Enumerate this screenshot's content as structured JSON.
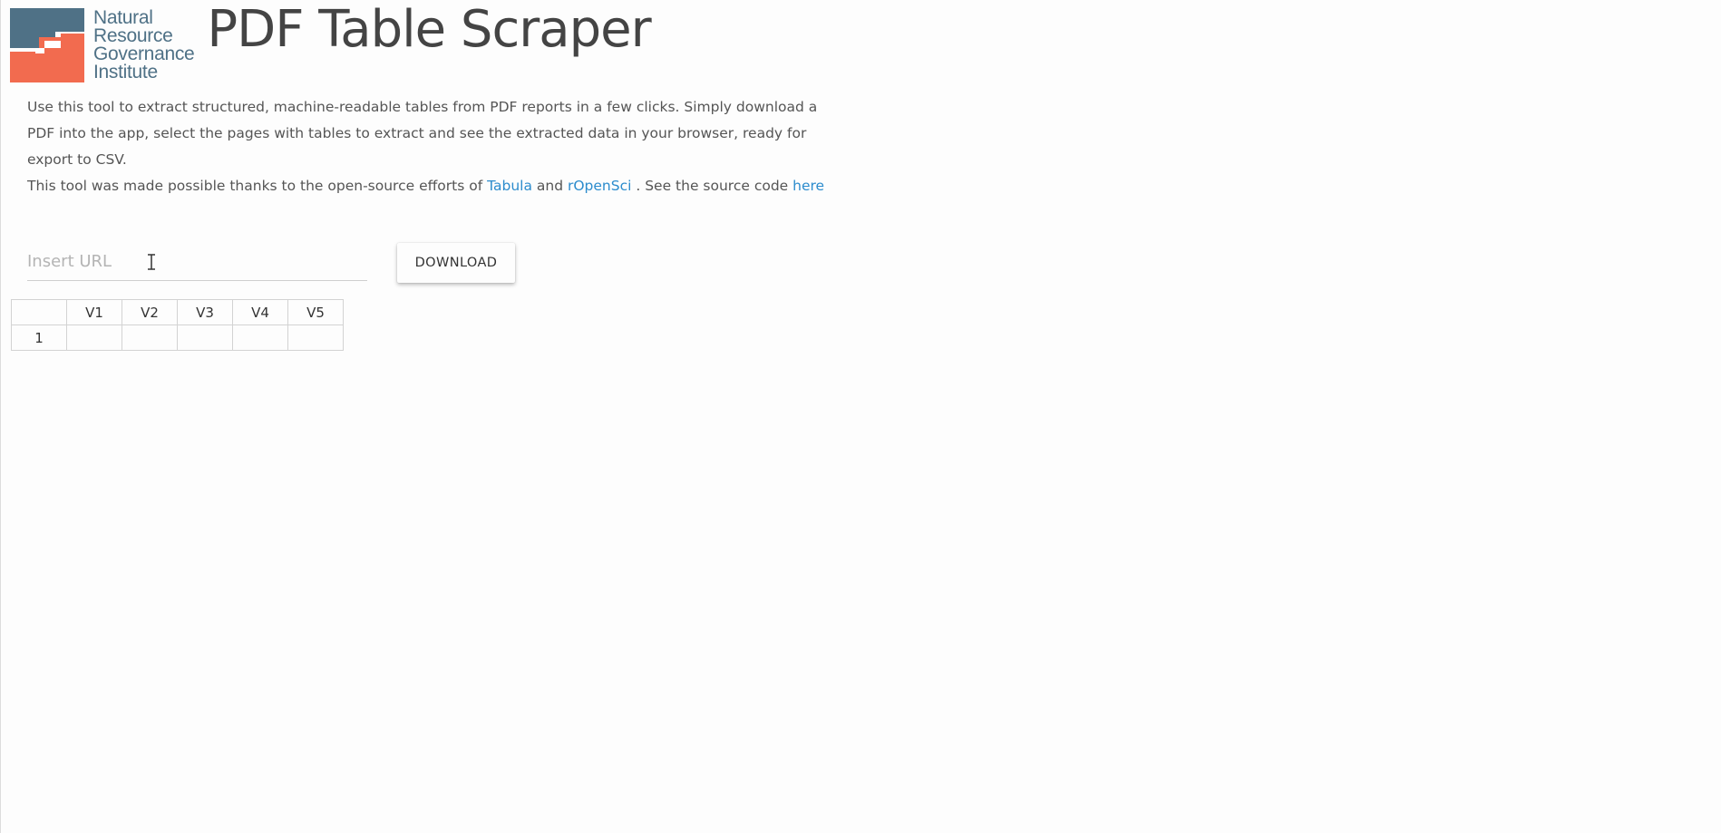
{
  "header": {
    "logo_lines": [
      "Natural",
      "Resource",
      "Governance",
      "Institute"
    ],
    "logo_colors": {
      "blue": "#4f7186",
      "orange": "#f26b4f"
    },
    "title": "PDF Table Scraper"
  },
  "intro": {
    "paragraph1": "Use this tool to extract structured, machine-readable tables from PDF reports in a few clicks. Simply download a PDF into the app, select the pages with tables to extract and see the extracted data in your browser, ready for export to CSV.",
    "paragraph2_prefix": "This tool was made possible thanks to the open-source efforts of ",
    "link_tabula": "Tabula",
    "and_text": " and ",
    "link_ropensci": "rOpenSci",
    "source_text": " . See the source code ",
    "link_here": "here"
  },
  "url_form": {
    "placeholder": "Insert URL",
    "value": "",
    "download_label": "DOWNLOAD"
  },
  "table": {
    "headers": [
      "",
      "V1",
      "V2",
      "V3",
      "V4",
      "V5"
    ],
    "rows": [
      [
        "1",
        "",
        "",
        "",
        "",
        ""
      ]
    ]
  },
  "colors": {
    "link": "#2c8ccd",
    "title": "#444444",
    "text": "#555555"
  }
}
